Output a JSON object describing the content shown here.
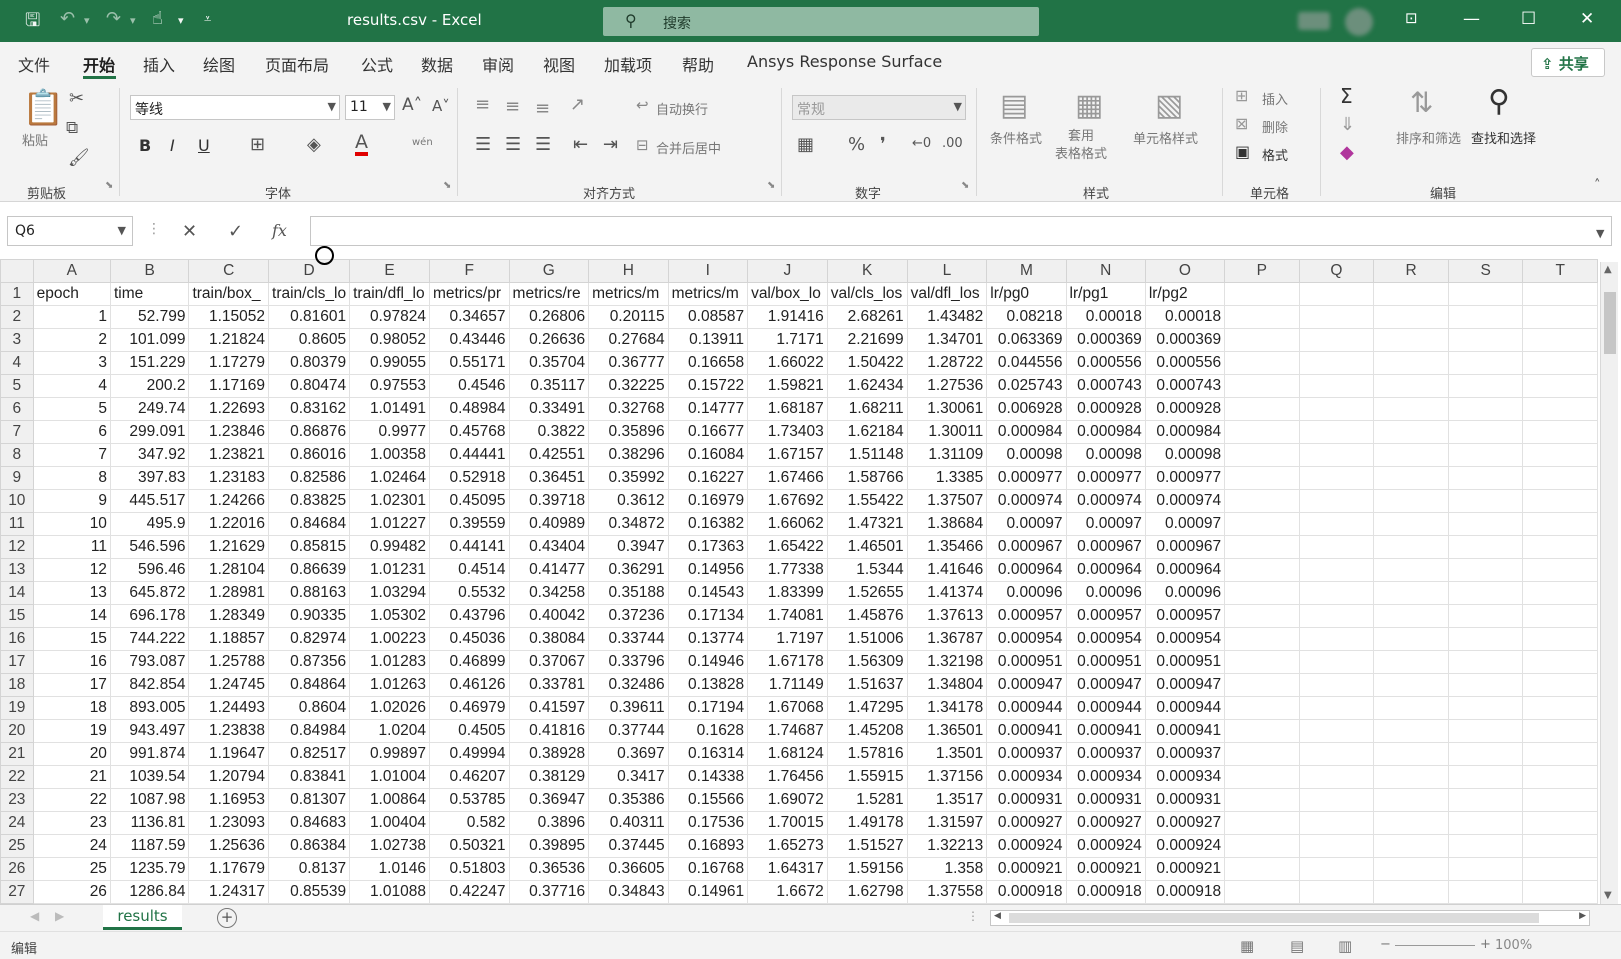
{
  "window": {
    "title": "results.csv  -  Excel",
    "search_placeholder": "搜索"
  },
  "menu": {
    "items": [
      "文件",
      "开始",
      "插入",
      "绘图",
      "页面布局",
      "公式",
      "数据",
      "审阅",
      "视图",
      "加载项",
      "帮助",
      "Ansys Response Surface"
    ],
    "share": "共享"
  },
  "ribbon": {
    "clipboard": {
      "paste": "粘贴",
      "label": "剪贴板"
    },
    "font": {
      "name": "等线",
      "size": "11",
      "label": "字体",
      "bold": "B",
      "italic": "I",
      "underline": "U",
      "wen": "wén"
    },
    "alignment": {
      "wrap": "自动换行",
      "merge": "合并后居中",
      "label": "对齐方式"
    },
    "number": {
      "format": "常规",
      "label": "数字"
    },
    "styles": {
      "conditional": "条件格式",
      "table_format": "套用\n表格格式",
      "cell_styles": "单元格样式",
      "label": "样式"
    },
    "cells": {
      "insert": "插入",
      "delete": "删除",
      "format": "格式",
      "label": "单元格"
    },
    "editing": {
      "sort": "排序和筛选",
      "find": "查找和选择",
      "label": "编辑"
    }
  },
  "formula_bar": {
    "name_box": "Q6",
    "fx": "fx",
    "content": ""
  },
  "columns": [
    "A",
    "B",
    "C",
    "D",
    "E",
    "F",
    "G",
    "H",
    "I",
    "J",
    "K",
    "L",
    "M",
    "N",
    "O",
    "P",
    "Q",
    "R",
    "S",
    "T"
  ],
  "header_row": [
    "epoch",
    "time",
    "train/box_",
    "train/cls_lo",
    "train/dfl_lo",
    "metrics/pr",
    "metrics/re",
    "metrics/m",
    "metrics/m",
    "val/box_lo",
    "val/cls_los",
    "val/dfl_los",
    "lr/pg0",
    "lr/pg1",
    "lr/pg2"
  ],
  "rows": [
    [
      "1",
      "52.799",
      "1.15052",
      "0.81601",
      "0.97824",
      "0.34657",
      "0.26806",
      "0.20115",
      "0.08587",
      "1.91416",
      "2.68261",
      "1.43482",
      "0.08218",
      "0.00018",
      "0.00018"
    ],
    [
      "2",
      "101.099",
      "1.21824",
      "0.8605",
      "0.98052",
      "0.43446",
      "0.26636",
      "0.27684",
      "0.13911",
      "1.7171",
      "2.21699",
      "1.34701",
      "0.063369",
      "0.000369",
      "0.000369"
    ],
    [
      "3",
      "151.229",
      "1.17279",
      "0.80379",
      "0.99055",
      "0.55171",
      "0.35704",
      "0.36777",
      "0.16658",
      "1.66022",
      "1.50422",
      "1.28722",
      "0.044556",
      "0.000556",
      "0.000556"
    ],
    [
      "4",
      "200.2",
      "1.17169",
      "0.80474",
      "0.97553",
      "0.4546",
      "0.35117",
      "0.32225",
      "0.15722",
      "1.59821",
      "1.62434",
      "1.27536",
      "0.025743",
      "0.000743",
      "0.000743"
    ],
    [
      "5",
      "249.74",
      "1.22693",
      "0.83162",
      "1.01491",
      "0.48984",
      "0.33491",
      "0.32768",
      "0.14777",
      "1.68187",
      "1.68211",
      "1.30061",
      "0.006928",
      "0.000928",
      "0.000928"
    ],
    [
      "6",
      "299.091",
      "1.23846",
      "0.86876",
      "0.9977",
      "0.45768",
      "0.3822",
      "0.35896",
      "0.16677",
      "1.73403",
      "1.62184",
      "1.30011",
      "0.000984",
      "0.000984",
      "0.000984"
    ],
    [
      "7",
      "347.92",
      "1.23821",
      "0.86016",
      "1.00358",
      "0.44441",
      "0.42551",
      "0.38296",
      "0.16084",
      "1.67157",
      "1.51148",
      "1.31109",
      "0.00098",
      "0.00098",
      "0.00098"
    ],
    [
      "8",
      "397.83",
      "1.23183",
      "0.82586",
      "1.02464",
      "0.52918",
      "0.36451",
      "0.35992",
      "0.16227",
      "1.67466",
      "1.58766",
      "1.3385",
      "0.000977",
      "0.000977",
      "0.000977"
    ],
    [
      "9",
      "445.517",
      "1.24266",
      "0.83825",
      "1.02301",
      "0.45095",
      "0.39718",
      "0.3612",
      "0.16979",
      "1.67692",
      "1.55422",
      "1.37507",
      "0.000974",
      "0.000974",
      "0.000974"
    ],
    [
      "10",
      "495.9",
      "1.22016",
      "0.84684",
      "1.01227",
      "0.39559",
      "0.40989",
      "0.34872",
      "0.16382",
      "1.66062",
      "1.47321",
      "1.38684",
      "0.00097",
      "0.00097",
      "0.00097"
    ],
    [
      "11",
      "546.596",
      "1.21629",
      "0.85815",
      "0.99482",
      "0.44141",
      "0.43404",
      "0.3947",
      "0.17363",
      "1.65422",
      "1.46501",
      "1.35466",
      "0.000967",
      "0.000967",
      "0.000967"
    ],
    [
      "12",
      "596.46",
      "1.28104",
      "0.86639",
      "1.01231",
      "0.4514",
      "0.41477",
      "0.36291",
      "0.14956",
      "1.77338",
      "1.5344",
      "1.41646",
      "0.000964",
      "0.000964",
      "0.000964"
    ],
    [
      "13",
      "645.872",
      "1.28981",
      "0.88163",
      "1.03294",
      "0.5532",
      "0.34258",
      "0.35188",
      "0.14543",
      "1.83399",
      "1.52655",
      "1.41374",
      "0.00096",
      "0.00096",
      "0.00096"
    ],
    [
      "14",
      "696.178",
      "1.28349",
      "0.90335",
      "1.05302",
      "0.43796",
      "0.40042",
      "0.37236",
      "0.17134",
      "1.74081",
      "1.45876",
      "1.37613",
      "0.000957",
      "0.000957",
      "0.000957"
    ],
    [
      "15",
      "744.222",
      "1.18857",
      "0.82974",
      "1.00223",
      "0.45036",
      "0.38084",
      "0.33744",
      "0.13774",
      "1.7197",
      "1.51006",
      "1.36787",
      "0.000954",
      "0.000954",
      "0.000954"
    ],
    [
      "16",
      "793.087",
      "1.25788",
      "0.87356",
      "1.01283",
      "0.46899",
      "0.37067",
      "0.33796",
      "0.14946",
      "1.67178",
      "1.56309",
      "1.32198",
      "0.000951",
      "0.000951",
      "0.000951"
    ],
    [
      "17",
      "842.854",
      "1.24745",
      "0.84864",
      "1.01263",
      "0.46126",
      "0.33781",
      "0.32486",
      "0.13828",
      "1.71149",
      "1.51637",
      "1.34804",
      "0.000947",
      "0.000947",
      "0.000947"
    ],
    [
      "18",
      "893.005",
      "1.24493",
      "0.8604",
      "1.02026",
      "0.46979",
      "0.41597",
      "0.39611",
      "0.17194",
      "1.67068",
      "1.47295",
      "1.34178",
      "0.000944",
      "0.000944",
      "0.000944"
    ],
    [
      "19",
      "943.497",
      "1.23838",
      "0.84984",
      "1.0204",
      "0.4505",
      "0.41816",
      "0.37744",
      "0.1628",
      "1.74687",
      "1.45208",
      "1.36501",
      "0.000941",
      "0.000941",
      "0.000941"
    ],
    [
      "20",
      "991.874",
      "1.19647",
      "0.82517",
      "0.99897",
      "0.49994",
      "0.38928",
      "0.3697",
      "0.16314",
      "1.68124",
      "1.57816",
      "1.3501",
      "0.000937",
      "0.000937",
      "0.000937"
    ],
    [
      "21",
      "1039.54",
      "1.20794",
      "0.83841",
      "1.01004",
      "0.46207",
      "0.38129",
      "0.3417",
      "0.14338",
      "1.76456",
      "1.55915",
      "1.37156",
      "0.000934",
      "0.000934",
      "0.000934"
    ],
    [
      "22",
      "1087.98",
      "1.16953",
      "0.81307",
      "1.00864",
      "0.53785",
      "0.36947",
      "0.35386",
      "0.15566",
      "1.69072",
      "1.5281",
      "1.3517",
      "0.000931",
      "0.000931",
      "0.000931"
    ],
    [
      "23",
      "1136.81",
      "1.23093",
      "0.84683",
      "1.00404",
      "0.582",
      "0.3896",
      "0.40311",
      "0.17536",
      "1.70015",
      "1.49178",
      "1.31597",
      "0.000927",
      "0.000927",
      "0.000927"
    ],
    [
      "24",
      "1187.59",
      "1.25636",
      "0.86384",
      "1.02738",
      "0.50321",
      "0.39895",
      "0.37445",
      "0.16893",
      "1.65273",
      "1.51527",
      "1.32213",
      "0.000924",
      "0.000924",
      "0.000924"
    ],
    [
      "25",
      "1235.79",
      "1.17679",
      "0.8137",
      "1.0146",
      "0.51803",
      "0.36536",
      "0.36605",
      "0.16768",
      "1.64317",
      "1.59156",
      "1.358",
      "0.000921",
      "0.000921",
      "0.000921"
    ],
    [
      "26",
      "1286.84",
      "1.24317",
      "0.85539",
      "1.01088",
      "0.42247",
      "0.37716",
      "0.34843",
      "0.14961",
      "1.6672",
      "1.62798",
      "1.37558",
      "0.000918",
      "0.000918",
      "0.000918"
    ]
  ],
  "sheet_tabs": [
    "results"
  ],
  "status": {
    "mode": "编辑",
    "zoom": "100%"
  }
}
